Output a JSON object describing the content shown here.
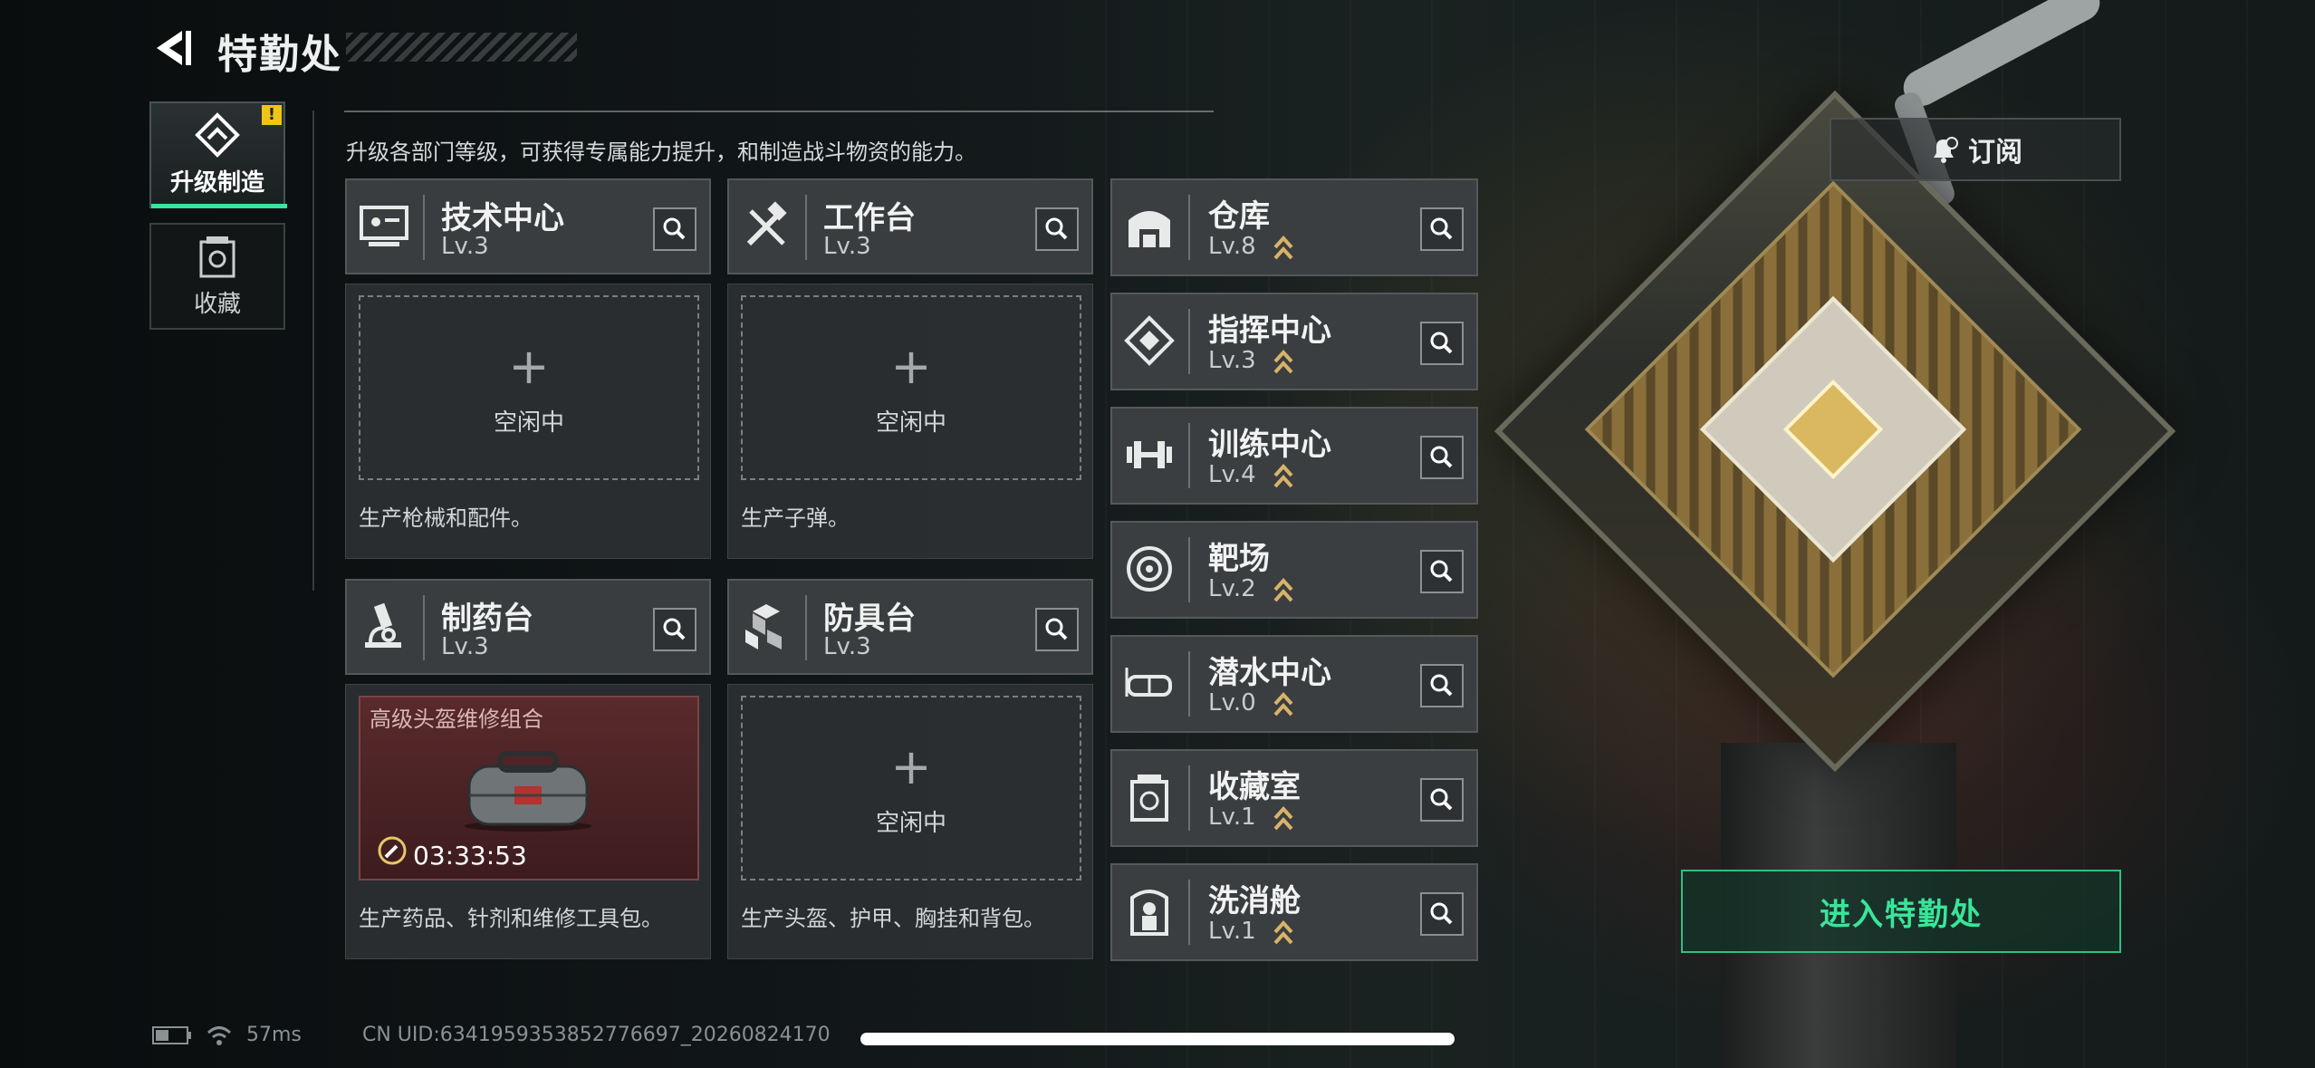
{
  "header": {
    "title": "特勤处"
  },
  "description": "升级各部门等级，可获得专属能力提升，和制造战斗物资的能力。",
  "side_tabs": [
    {
      "label": "升级制造",
      "active": true,
      "icon": "upgrade-icon",
      "badge": "!"
    },
    {
      "label": "收藏",
      "active": false,
      "icon": "collection-icon"
    }
  ],
  "modules": [
    {
      "name": "技术中心",
      "level": "Lv.3",
      "icon": "tech-center-icon",
      "status": "空闲中",
      "footer": "生产枪械和配件。"
    },
    {
      "name": "工作台",
      "level": "Lv.3",
      "icon": "tools-icon",
      "status": "空闲中",
      "footer": "生产子弹。"
    },
    {
      "name": "制药台",
      "level": "Lv.3",
      "icon": "microscope-icon",
      "craft_item": "高级头盔维修组合",
      "timer": "03:33:53",
      "footer": "生产药品、针剂和维修工具包。"
    },
    {
      "name": "防具台",
      "level": "Lv.3",
      "icon": "boxes-icon",
      "status": "空闲中",
      "footer": "生产头盔、护甲、胸挂和背包。"
    }
  ],
  "facilities": [
    {
      "name": "仓库",
      "level": "Lv.8",
      "icon": "warehouse-icon"
    },
    {
      "name": "指挥中心",
      "level": "Lv.3",
      "icon": "command-icon"
    },
    {
      "name": "训练中心",
      "level": "Lv.4",
      "icon": "dumbbell-icon"
    },
    {
      "name": "靶场",
      "level": "Lv.2",
      "icon": "target-icon"
    },
    {
      "name": "潜水中心",
      "level": "Lv.0",
      "icon": "diving-mask-icon"
    },
    {
      "name": "收藏室",
      "level": "Lv.1",
      "icon": "collection-room-icon"
    },
    {
      "name": "洗消舱",
      "level": "Lv.1",
      "icon": "decon-icon"
    }
  ],
  "subscribe_label": "订阅",
  "enter_label": "进入特勤处",
  "status_bar": {
    "ping": "57ms",
    "uid": "CN UID:6341959353852776697_20260824170"
  },
  "colors": {
    "accent": "#37e59c",
    "card": "#3a3d3f",
    "upgrade": "#d7b36a",
    "warning": "#f0c318"
  }
}
